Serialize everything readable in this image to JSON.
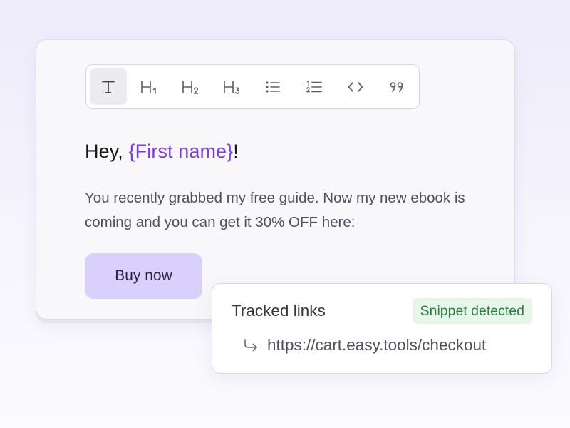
{
  "toolbar": {
    "tools": [
      {
        "name": "text",
        "glyph": "T",
        "active": true
      },
      {
        "name": "heading-1",
        "glyph": "H",
        "sub": "1"
      },
      {
        "name": "heading-2",
        "glyph": "H",
        "sub": "2"
      },
      {
        "name": "heading-3",
        "glyph": "H",
        "sub": "3"
      },
      {
        "name": "bullet-list",
        "icon": "bullet-list-icon"
      },
      {
        "name": "numbered-list",
        "icon": "numbered-list-icon"
      },
      {
        "name": "code",
        "icon": "code-icon"
      },
      {
        "name": "quote",
        "icon": "quote-icon"
      }
    ]
  },
  "email": {
    "greeting_prefix": "Hey, ",
    "greeting_variable": "{First name}",
    "greeting_suffix": "!",
    "body": "You recently grabbed my free guide. Now my new ebook is coming and you can get it 30% OFF here:",
    "cta_label": "Buy now"
  },
  "tracked_links": {
    "title": "Tracked links",
    "badge": "Snippet detected",
    "links": [
      {
        "icon": "return-arrow-icon",
        "url": "https://cart.easy.tools/checkout"
      }
    ]
  },
  "colors": {
    "accent": "#7c3aed",
    "cta_bg": "#d9d0fd",
    "badge_bg": "#e6f7ea",
    "badge_text": "#2e7d45"
  }
}
